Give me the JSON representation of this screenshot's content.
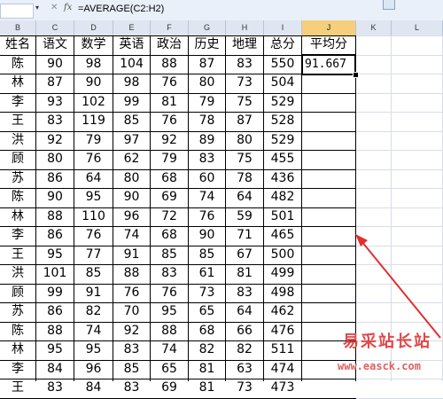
{
  "formula_bar": {
    "name_box_arrow": "▾",
    "cancel_icon": "✕",
    "fx_label": "fx",
    "formula": "=AVERAGE(C2:H2)"
  },
  "columns": [
    "B",
    "C",
    "D",
    "E",
    "F",
    "G",
    "H",
    "I",
    "J",
    "K",
    "L"
  ],
  "selected_column": "J",
  "header_row": [
    "姓名",
    "语文",
    "数学",
    "英语",
    "政治",
    "历史",
    "地理",
    "总分",
    "平均分"
  ],
  "rows": [
    [
      "陈",
      "90",
      "98",
      "104",
      "88",
      "87",
      "83",
      "550",
      "91.667"
    ],
    [
      "林",
      "87",
      "90",
      "98",
      "76",
      "80",
      "73",
      "504",
      ""
    ],
    [
      "李",
      "93",
      "102",
      "99",
      "81",
      "79",
      "75",
      "529",
      ""
    ],
    [
      "王",
      "83",
      "119",
      "85",
      "76",
      "78",
      "87",
      "528",
      ""
    ],
    [
      "洪",
      "92",
      "79",
      "97",
      "92",
      "89",
      "80",
      "529",
      ""
    ],
    [
      "顾",
      "80",
      "76",
      "62",
      "79",
      "83",
      "75",
      "455",
      ""
    ],
    [
      "苏",
      "86",
      "64",
      "80",
      "68",
      "60",
      "78",
      "436",
      ""
    ],
    [
      "陈",
      "90",
      "95",
      "90",
      "69",
      "74",
      "64",
      "482",
      ""
    ],
    [
      "林",
      "88",
      "110",
      "96",
      "72",
      "76",
      "59",
      "501",
      ""
    ],
    [
      "李",
      "86",
      "76",
      "74",
      "68",
      "90",
      "71",
      "465",
      ""
    ],
    [
      "王",
      "95",
      "77",
      "91",
      "85",
      "85",
      "67",
      "500",
      ""
    ],
    [
      "洪",
      "101",
      "85",
      "88",
      "83",
      "61",
      "81",
      "499",
      ""
    ],
    [
      "顾",
      "99",
      "91",
      "76",
      "76",
      "73",
      "83",
      "498",
      ""
    ],
    [
      "苏",
      "86",
      "82",
      "70",
      "95",
      "65",
      "64",
      "462",
      ""
    ],
    [
      "陈",
      "88",
      "74",
      "92",
      "88",
      "68",
      "66",
      "476",
      ""
    ],
    [
      "林",
      "95",
      "95",
      "83",
      "74",
      "82",
      "82",
      "511",
      ""
    ],
    [
      "李",
      "84",
      "96",
      "85",
      "65",
      "81",
      "63",
      "474",
      ""
    ],
    [
      "王",
      "83",
      "84",
      "83",
      "69",
      "81",
      "73",
      "473",
      ""
    ]
  ],
  "watermark": {
    "title": "易采站长站",
    "url": "www.easck.com"
  },
  "colors": {
    "selected_header": "#f6cf7c",
    "annotation_arrow": "#e03030",
    "watermark": "#e04848"
  }
}
